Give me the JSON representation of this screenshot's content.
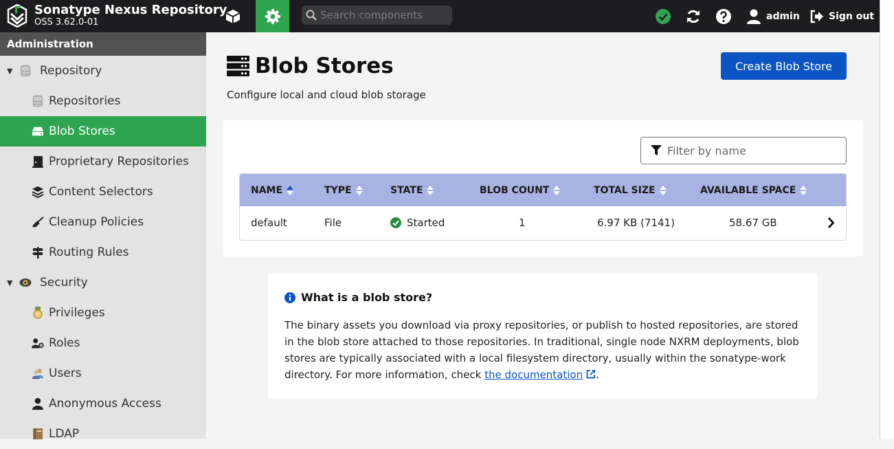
{
  "header": {
    "brand_name": "Sonatype Nexus Repository",
    "brand_version": "OSS 3.62.0-01",
    "search_placeholder": "Search components",
    "user_label": "admin",
    "signout_label": "Sign out",
    "admin_active_color": "#2fa44f",
    "status_color": "#2fa44f"
  },
  "sidebar": {
    "title": "Administration",
    "groups": [
      {
        "label": "Repository",
        "icon": "database-icon",
        "items": [
          {
            "label": "Repositories",
            "icon": "database-icon"
          },
          {
            "label": "Blob Stores",
            "icon": "hard-drive-icon",
            "active": true
          },
          {
            "label": "Proprietary Repositories",
            "icon": "door-icon"
          },
          {
            "label": "Content Selectors",
            "icon": "layers-icon"
          },
          {
            "label": "Cleanup Policies",
            "icon": "broom-icon"
          },
          {
            "label": "Routing Rules",
            "icon": "signpost-icon"
          }
        ]
      },
      {
        "label": "Security",
        "icon": "eye-icon",
        "items": [
          {
            "label": "Privileges",
            "icon": "medal-icon"
          },
          {
            "label": "Roles",
            "icon": "user-role-icon"
          },
          {
            "label": "Users",
            "icon": "users-icon"
          },
          {
            "label": "Anonymous Access",
            "icon": "user-icon"
          },
          {
            "label": "LDAP",
            "icon": "book-icon"
          }
        ]
      }
    ]
  },
  "main": {
    "title": "Blob Stores",
    "description": "Configure local and cloud blob storage",
    "create_button": "Create Blob Store",
    "filter_placeholder": "Filter by name",
    "table": {
      "columns": [
        "NAME",
        "TYPE",
        "STATE",
        "BLOB COUNT",
        "TOTAL SIZE",
        "AVAILABLE SPACE"
      ],
      "sorted_column": "NAME",
      "rows": [
        {
          "name": "default",
          "type": "File",
          "state": "Started",
          "blob_count": "1",
          "total_size": "6.97 KB (7141)",
          "available_space": "58.67 GB"
        }
      ]
    },
    "info": {
      "title": "What is a blob store?",
      "text": "The binary assets you download via proxy repositories, or publish to hosted repositories, are stored in the blob store attached to those repositories. In traditional, single node NXRM deployments, blob stores are typically associated with a local filesystem directory, usually within the sonatype-work directory. For more information, check ",
      "link_label": "the documentation",
      "text_end": "."
    }
  }
}
